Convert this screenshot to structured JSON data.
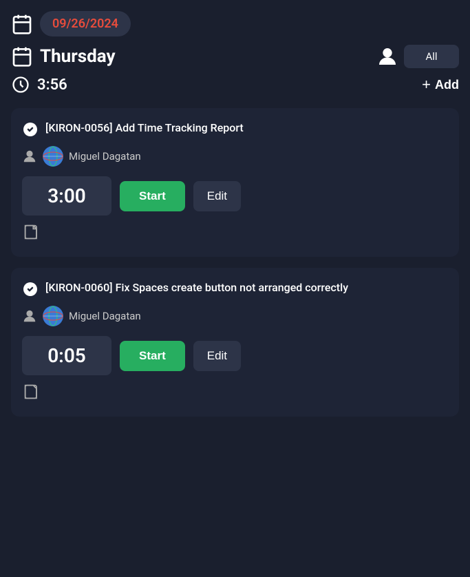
{
  "header": {
    "date": "09/26/2024",
    "day": "Thursday",
    "time": "3:56",
    "filter_label": "All",
    "add_label": "Add"
  },
  "tasks": [
    {
      "id": "task-1",
      "title": "[KIRON-0056] Add Time Tracking Report",
      "assignee": "Miguel Dagatan",
      "timer": "3:00",
      "start_label": "Start",
      "edit_label": "Edit"
    },
    {
      "id": "task-2",
      "title": "[KIRON-0060] Fix Spaces  create button not arranged correctly",
      "assignee": "Miguel Dagatan",
      "timer": "0:05",
      "start_label": "Start",
      "edit_label": "Edit"
    }
  ]
}
